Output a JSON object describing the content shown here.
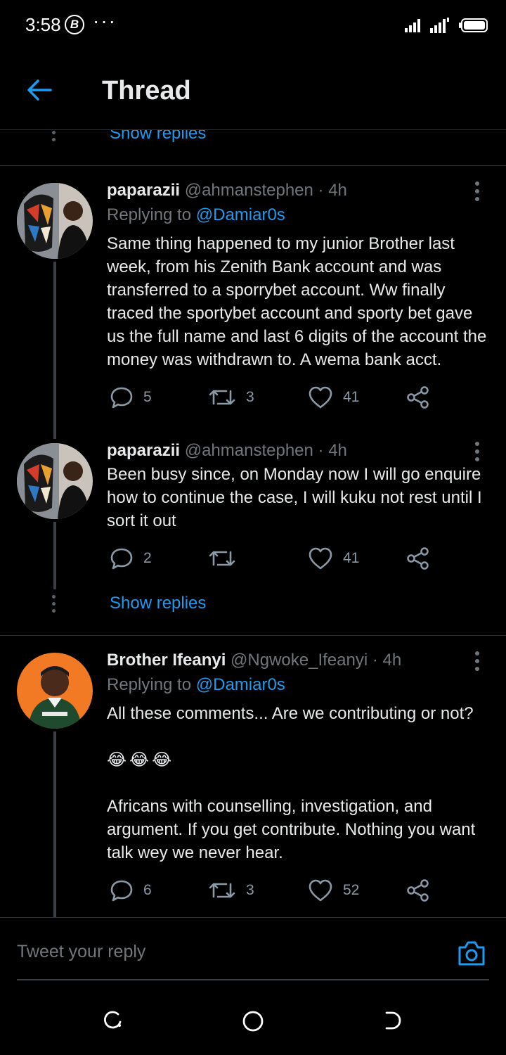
{
  "status": {
    "time": "3:58",
    "b_icon": "B",
    "dots": "···"
  },
  "header": {
    "title": "Thread"
  },
  "partial": {
    "show_replies": "Show replies"
  },
  "tweets": [
    {
      "name": "paparazii",
      "handle": "@ahmanstephen · 4h",
      "replying_prefix": "Replying to",
      "replying_to": "@Damiar0s",
      "body": "Same thing happened to my junior Brother last week, from his Zenith Bank account and was transferred to a sporrybet account. Ww finally traced the sportybet account and sporty bet gave us the full name and last 6 digits of the account the money was withdrawn to. A wema bank acct.",
      "replies": "5",
      "retweets": "3",
      "likes": "41"
    },
    {
      "name": "paparazii",
      "handle": "@ahmanstephen · 4h",
      "body": "Been busy since, on Monday now I will go enquire how to continue the case, I will kuku not rest until I sort it out",
      "replies": "2",
      "retweets": "",
      "likes": "41",
      "show_replies": "Show replies"
    },
    {
      "name": "Brother Ifeanyi",
      "handle": "@Ngwoke_Ifeanyi · 4h",
      "replying_prefix": "Replying to",
      "replying_to": "@Damiar0s",
      "body_line1": "All these comments... Are we contributing or not?",
      "emoji": "😂😂😂",
      "body_line2": "Africans with counselling, investigation, and argument. If you get contribute. Nothing you want talk wey we never hear.",
      "replies": "6",
      "retweets": "3",
      "likes": "52"
    }
  ],
  "reply_bar": {
    "placeholder": "Tweet your reply"
  },
  "colors": {
    "accent": "#1d9bf0",
    "background": "#000000",
    "muted": "#71767b",
    "text": "#e7e9ea"
  },
  "icons": [
    "back-arrow-icon",
    "reply-icon",
    "retweet-icon",
    "like-icon",
    "share-icon",
    "camera-icon",
    "more-icon"
  ]
}
